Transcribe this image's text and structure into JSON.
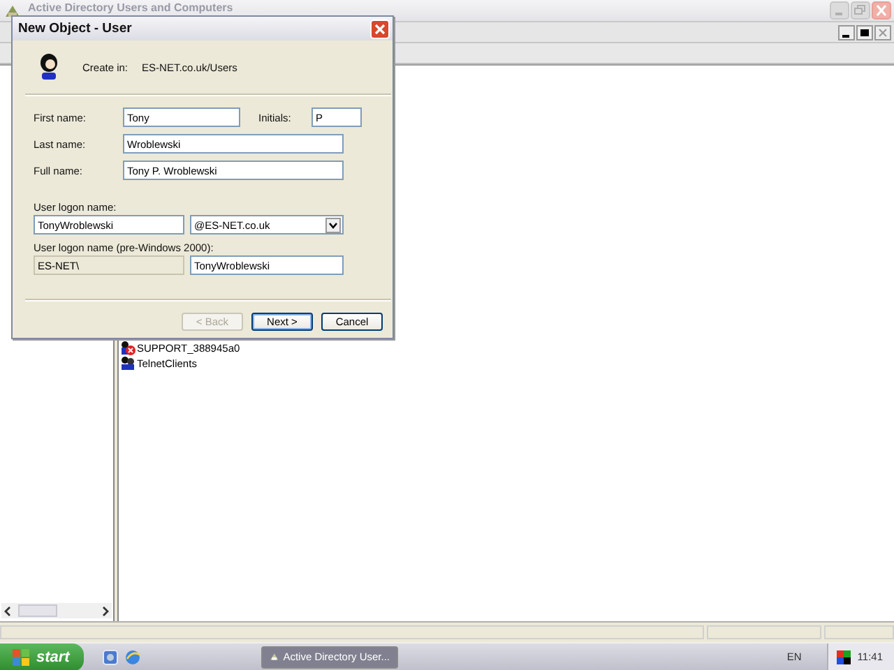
{
  "main_window": {
    "title": "Active Directory Users and Computers",
    "list_items": [
      {
        "name": "SUPPORT_388945a0",
        "kind": "disabled-user"
      },
      {
        "name": "TelnetClients",
        "kind": "group"
      }
    ]
  },
  "dialog": {
    "title": "New Object - User",
    "create_in_label": "Create in:",
    "create_in_path": "ES-NET.co.uk/Users",
    "first_name": {
      "label": "First name:",
      "value": "Tony"
    },
    "initials": {
      "label": "Initials:",
      "value": "P"
    },
    "last_name": {
      "label": "Last name:",
      "value": "Wroblewski"
    },
    "full_name": {
      "label": "Full name:",
      "value": "Tony P. Wroblewski"
    },
    "logon_name": {
      "label": "User logon name:",
      "value": "TonyWroblewski",
      "domain": "@ES-NET.co.uk"
    },
    "pre2000": {
      "label": "User logon name (pre-Windows 2000):",
      "domain": "ES-NET\\",
      "value": "TonyWroblewski"
    },
    "buttons": [
      {
        "label": "< Back",
        "disabled": true,
        "default": false
      },
      {
        "label": "Next >",
        "disabled": false,
        "default": true
      },
      {
        "label": "Cancel",
        "disabled": false,
        "default": false
      }
    ]
  },
  "taskbar": {
    "start": "start",
    "tasks": [
      {
        "label": "Active Directory User...",
        "selected": true
      }
    ],
    "language": "EN",
    "clock": "11:41"
  }
}
